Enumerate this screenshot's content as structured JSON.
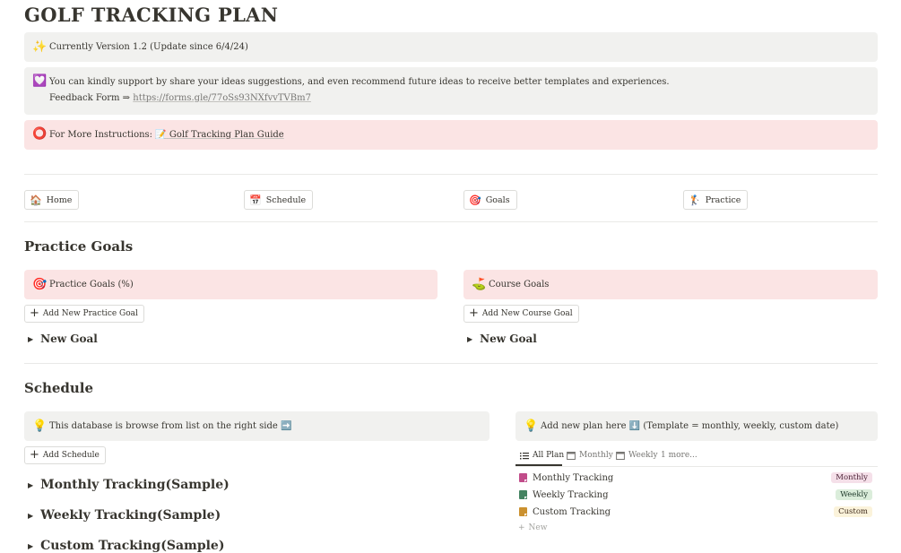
{
  "page": {
    "title": "GOLF TRACKING PLAN"
  },
  "callouts": {
    "version": {
      "icon": "✨",
      "text": "Currently Version 1.2 (Update since 6/4/24)"
    },
    "support": {
      "icon": "💟",
      "text": "You can kindly support by share your ideas suggestions, and even recommend future ideas to receive better templates and experiences.",
      "feedback_label": "Feedback Form ⇒ ",
      "feedback_url": "https://forms.gle/77oSs93NXfvvTVBm7"
    },
    "instructions": {
      "icon": "⭕",
      "label": "For More Instructions: ",
      "link_icon": "📝",
      "link_text": "Golf Tracking Plan Guide"
    }
  },
  "nav": [
    {
      "icon": "🏠",
      "label": "Home"
    },
    {
      "icon": "📅",
      "label": "Schedule"
    },
    {
      "icon": "🎯",
      "label": "Goals"
    },
    {
      "icon": "🏌",
      "label": "Practice"
    }
  ],
  "practice_goals": {
    "heading": "Practice Goals",
    "left": {
      "icon": "🎯",
      "title": "Practice Goals (%)",
      "add_label": "Add New Practice Goal",
      "toggle": "New Goal"
    },
    "right": {
      "icon": "⛳",
      "title": "Course Goals",
      "add_label": "Add New Course Goal",
      "toggle": "New Goal"
    }
  },
  "schedule": {
    "heading": "Schedule",
    "left_callout": {
      "icon": "💡",
      "text": "This database is browse from list on the right side ➡️"
    },
    "add_label": "Add Schedule",
    "toggles": [
      "Monthly Tracking(Sample)",
      "Weekly Tracking(Sample)",
      "Custom Tracking(Sample)"
    ],
    "right_callout": {
      "icon": "💡",
      "text": "Add new plan here ⬇️ (Template = monthly, weekly, custom date)"
    },
    "tabs": [
      {
        "label": "All Plan",
        "icon": "list-icon"
      },
      {
        "label": "Monthly",
        "icon": "calendar-icon"
      },
      {
        "label": "Weekly",
        "icon": "calendar-icon"
      },
      {
        "label": "1 more...",
        "icon": ""
      }
    ],
    "rows": [
      {
        "title": "Monthly Tracking",
        "badge": "Monthly",
        "icon_color": "#c14c8a",
        "badge_bg": "#f5e0e9",
        "badge_color": "#4c2337"
      },
      {
        "title": "Weekly Tracking",
        "badge": "Weekly",
        "icon_color": "#448361",
        "badge_bg": "#dbeddb",
        "badge_color": "#1c3829"
      },
      {
        "title": "Custom Tracking",
        "badge": "Custom",
        "icon_color": "#cb912f",
        "badge_bg": "#fbf3db",
        "badge_color": "#402c1b"
      }
    ],
    "new_label": "New"
  }
}
